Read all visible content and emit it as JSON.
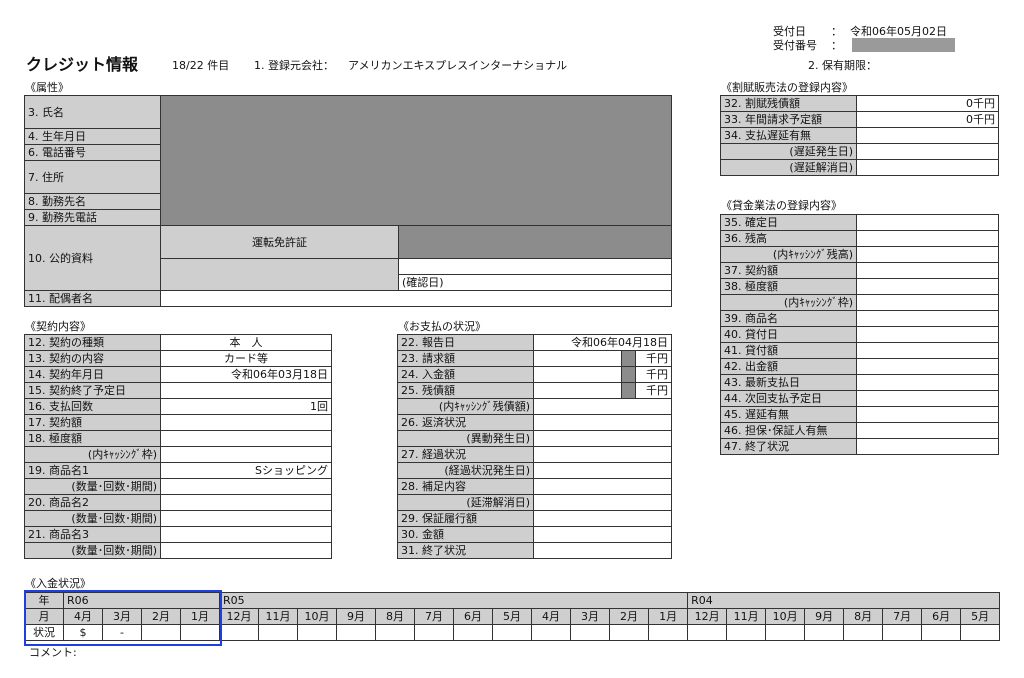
{
  "header": {
    "receipt_date_label": "受付日",
    "receipt_date_sep": "：",
    "receipt_date_value": "令和06年05月02日",
    "receipt_no_label": "受付番号",
    "receipt_no_sep": "：",
    "title": "クレジット情報",
    "count": "18/22 件目",
    "reg_company_label": "1. 登録元会社：",
    "reg_company_value": "アメリカンエキスプレスインターナショナル",
    "retention_label": "2. 保有期限："
  },
  "attributes": {
    "section": "《属性》",
    "name": "3. 氏名",
    "birth": "4. 生年月日",
    "phone": "6. 電話番号",
    "address": "7. 住所",
    "employer": "8. 勤務先名",
    "employer_phone": "9. 勤務先電話",
    "public_docs": "10. 公的資料",
    "license": "運転免許証",
    "confirm_date": "(確認日)",
    "spouse": "11. 配偶者名"
  },
  "contract": {
    "section": "《契約内容》",
    "rows": [
      {
        "label": "12. 契約の種類",
        "value": "本　人",
        "align": "c"
      },
      {
        "label": "13. 契約の内容",
        "value": "カード等",
        "align": "c"
      },
      {
        "label": "14. 契約年月日",
        "value": "令和06年03月18日",
        "align": "r"
      },
      {
        "label": "15. 契約終了予定日",
        "value": "",
        "align": "r"
      },
      {
        "label": "16. 支払回数",
        "value": "1回",
        "align": "r"
      },
      {
        "label": "17. 契約額",
        "value": "",
        "align": "r"
      },
      {
        "label": "18. 極度額",
        "value": "",
        "align": "r"
      },
      {
        "label": "(内ｷｬｯｼﾝｸﾞ枠)",
        "value": "",
        "align": "r",
        "indent": true
      },
      {
        "label": "19. 商品名1",
        "value": "Sショッピング",
        "align": "r"
      },
      {
        "label": "(数量･回数･期間)",
        "value": "",
        "align": "r",
        "indent": true
      },
      {
        "label": "20. 商品名2",
        "value": "",
        "align": "r"
      },
      {
        "label": "(数量･回数･期間)",
        "value": "",
        "align": "r",
        "indent": true
      },
      {
        "label": "21. 商品名3",
        "value": "",
        "align": "r"
      },
      {
        "label": "(数量･回数･期間)",
        "value": "",
        "align": "r",
        "indent": true
      }
    ]
  },
  "payment": {
    "section": "《お支払の状況》",
    "rows": [
      {
        "label": "22. 報告日",
        "value": "令和06年04月18日",
        "unit": ""
      },
      {
        "label": "23. 請求額",
        "value": "",
        "unit": "千円"
      },
      {
        "label": "24. 入金額",
        "value": "",
        "unit": "千円"
      },
      {
        "label": "25. 残債額",
        "value": "",
        "unit": "千円"
      },
      {
        "label": "(内ｷｬｯｼﾝｸﾞ残債額)",
        "value": "",
        "unit": "",
        "indent": true
      },
      {
        "label": "26. 返済状況",
        "value": "",
        "unit": ""
      },
      {
        "label": "(異動発生日)",
        "value": "",
        "unit": "",
        "indent": true
      },
      {
        "label": "27. 経過状況",
        "value": "",
        "unit": ""
      },
      {
        "label": "(経過状況発生日)",
        "value": "",
        "unit": "",
        "indent": true
      },
      {
        "label": "28. 補足内容",
        "value": "",
        "unit": ""
      },
      {
        "label": "(延滞解消日)",
        "value": "",
        "unit": "",
        "indent": true
      },
      {
        "label": "29. 保証履行額",
        "value": "",
        "unit": ""
      },
      {
        "label": "30. 金額",
        "value": "",
        "unit": ""
      },
      {
        "label": "31. 終了状況",
        "value": "",
        "unit": ""
      }
    ]
  },
  "installment": {
    "section": "《割賦販売法の登録内容》",
    "rows": [
      {
        "label": "32. 割賦残債額",
        "value": "0千円"
      },
      {
        "label": "33. 年間請求予定額",
        "value": "0千円"
      },
      {
        "label": "34. 支払遅延有無",
        "value": ""
      },
      {
        "label": "(遅延発生日)",
        "value": "",
        "indent": true
      },
      {
        "label": "(遅延解消日)",
        "value": "",
        "indent": true
      }
    ]
  },
  "money_lending": {
    "section": "《貸金業法の登録内容》",
    "rows": [
      {
        "label": "35. 確定日",
        "value": ""
      },
      {
        "label": "36. 残高",
        "value": ""
      },
      {
        "label": "(内ｷｬｯｼﾝｸﾞ残高)",
        "value": "",
        "indent": true
      },
      {
        "label": "37. 契約額",
        "value": ""
      },
      {
        "label": "38. 極度額",
        "value": ""
      },
      {
        "label": "(内ｷｬｯｼﾝｸﾞ枠)",
        "value": "",
        "indent": true
      },
      {
        "label": "39. 商品名",
        "value": ""
      },
      {
        "label": "40. 貸付日",
        "value": ""
      },
      {
        "label": "41. 貸付額",
        "value": ""
      },
      {
        "label": "42. 出金額",
        "value": ""
      },
      {
        "label": "43. 最新支払日",
        "value": ""
      },
      {
        "label": "44. 次回支払予定日",
        "value": ""
      },
      {
        "label": "45. 遅延有無",
        "value": ""
      },
      {
        "label": "46. 担保･保証人有無",
        "value": ""
      },
      {
        "label": "47. 終了状況",
        "value": ""
      }
    ]
  },
  "deposit": {
    "section": "《入金状況》",
    "year_label": "年",
    "month_label": "月",
    "status_label": "状況",
    "years": [
      {
        "name": "R06",
        "span": 4
      },
      {
        "name": "R05",
        "span": 12
      },
      {
        "name": "R04",
        "span": 8
      }
    ],
    "months": [
      "4月",
      "3月",
      "2月",
      "1月",
      "12月",
      "11月",
      "10月",
      "9月",
      "8月",
      "7月",
      "6月",
      "5月",
      "4月",
      "3月",
      "2月",
      "1月",
      "12月",
      "11月",
      "10月",
      "9月",
      "8月",
      "7月",
      "6月",
      "5月"
    ],
    "status": [
      "$",
      "-",
      "",
      "",
      "",
      "",
      "",
      "",
      "",
      "",
      "",
      "",
      "",
      "",
      "",
      "",
      "",
      "",
      "",
      "",
      "",
      "",
      "",
      ""
    ],
    "comment_label": "コメント:"
  }
}
